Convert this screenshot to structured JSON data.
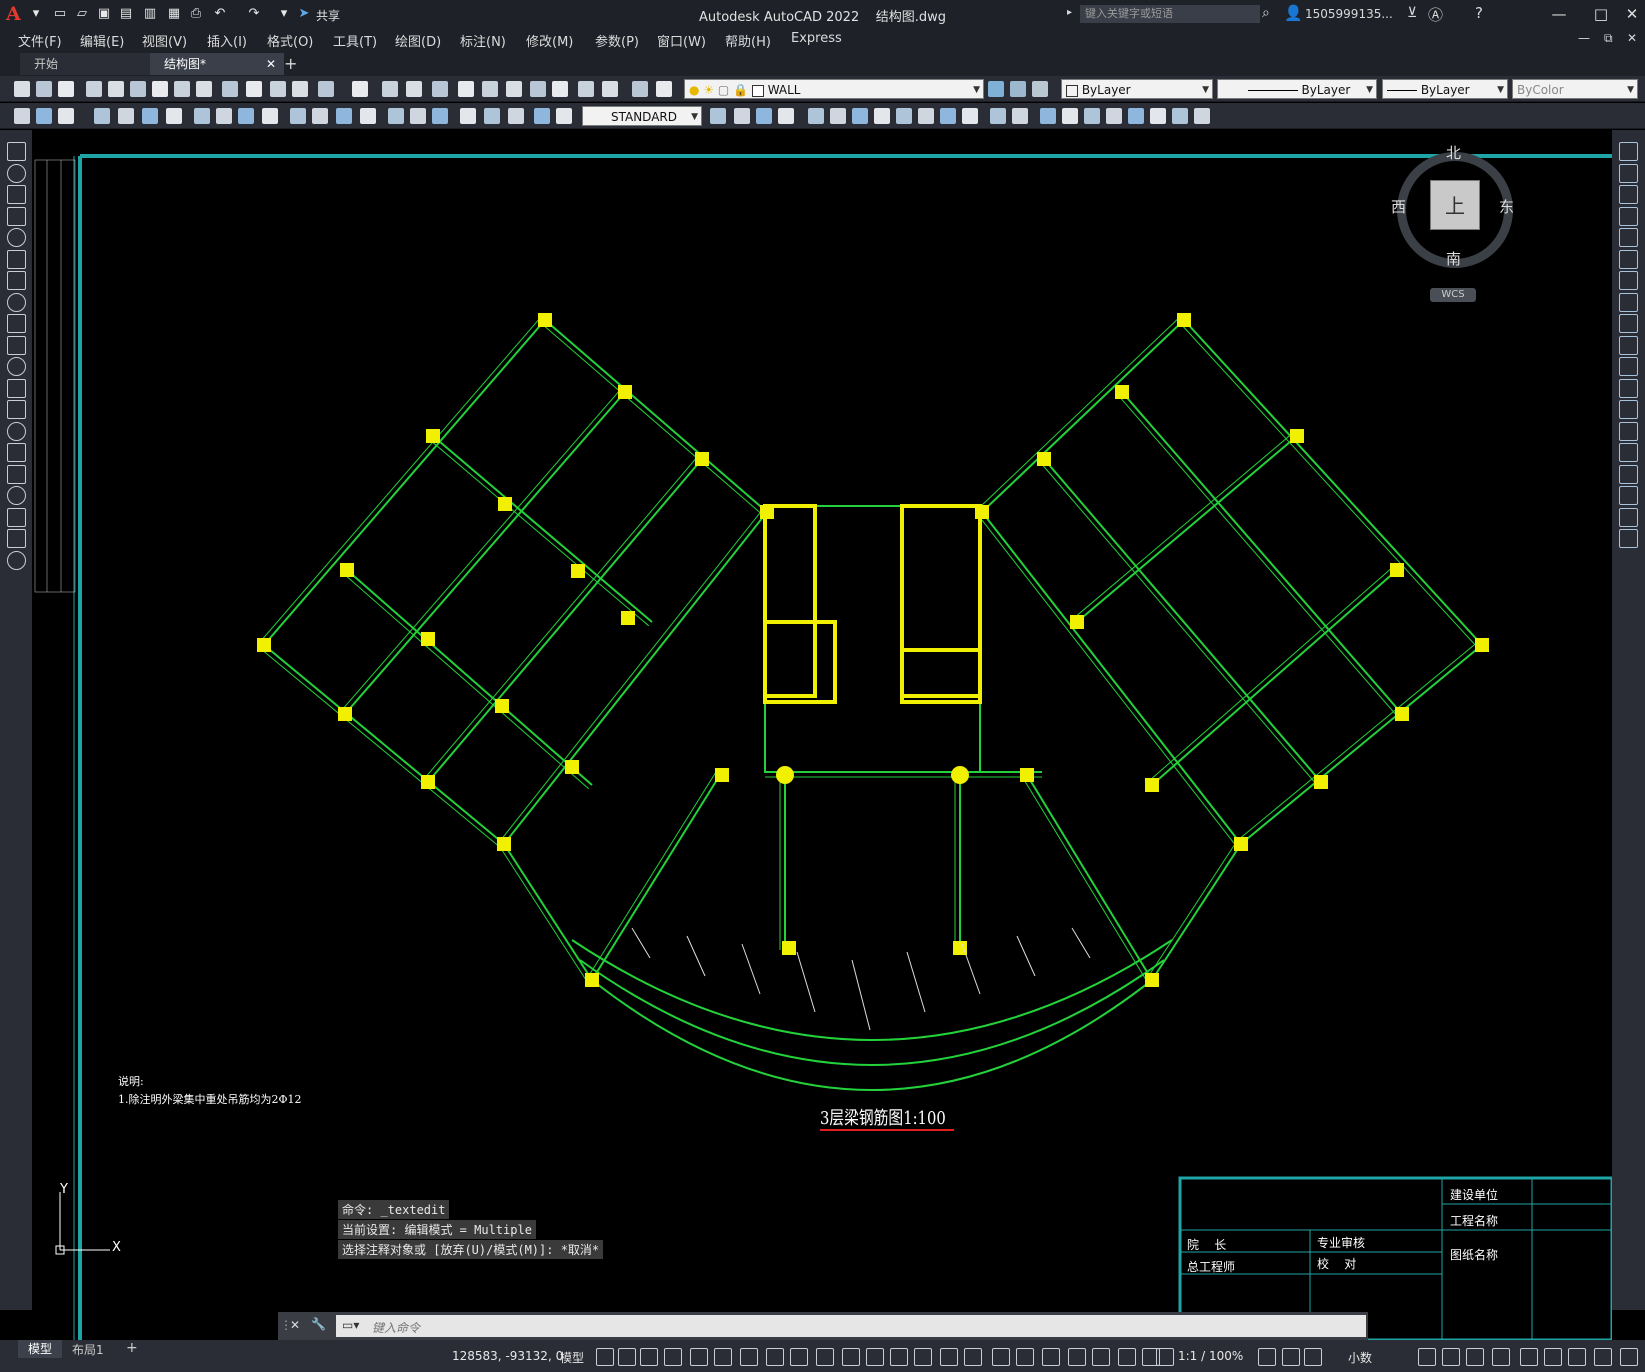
{
  "app": {
    "title": "Autodesk AutoCAD 2022",
    "file": "结构图.dwg",
    "logo": "A",
    "share": "共享",
    "search_placeholder": "键入关键字或短语",
    "user": "1505999135...",
    "window_controls": [
      "minimize",
      "maximize",
      "close"
    ]
  },
  "menu": [
    "文件(F)",
    "编辑(E)",
    "视图(V)",
    "插入(I)",
    "格式(O)",
    "工具(T)",
    "绘图(D)",
    "标注(N)",
    "修改(M)",
    "参数(P)",
    "窗口(W)",
    "帮助(H)",
    "Express"
  ],
  "tabs": [
    {
      "label": "开始",
      "active": false
    },
    {
      "label": "结构图*",
      "active": true
    }
  ],
  "toolbar": {
    "layer": "WALL",
    "color": "ByLayer",
    "linetype": "ByLayer",
    "lineweight": "ByLayer",
    "plotstyle": "ByColor",
    "textstyle": "STANDARD"
  },
  "viewcube": {
    "north": "北",
    "south": "南",
    "east": "东",
    "west": "西",
    "face": "上",
    "wcs": "WCS"
  },
  "drawing": {
    "title": "3层梁钢筋图1:100",
    "note_title": "说明:",
    "note_line": "1.除注明外梁集中重处吊筋均为2Φ12"
  },
  "titleblock": {
    "cells": [
      "建设单位",
      "工程名称",
      "图纸名称",
      "专业审核",
      "院    长",
      "校    对",
      "总工程师"
    ]
  },
  "command": {
    "history": [
      "命令: _textedit",
      "当前设置: 编辑模式 = Multiple",
      "选择注释对象或 [放弃(U)/模式(M)]: *取消*"
    ],
    "prompt": "键入命令"
  },
  "status": {
    "layout_tabs": [
      "模型",
      "布局1"
    ],
    "coords": "128583, -93132, 0",
    "model": "模型",
    "scale": "1:1 / 100%",
    "units": "小数"
  },
  "ucs": {
    "y": "Y",
    "x": "X"
  }
}
